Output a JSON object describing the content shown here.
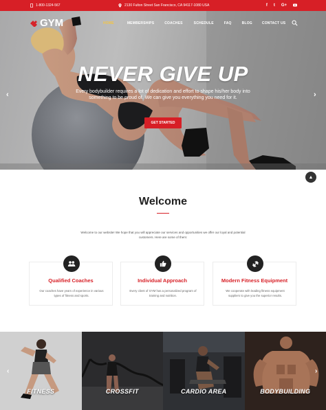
{
  "topbar": {
    "phone": "1-800-1324-567",
    "address": "2130 Fulton Street San Francisco, CA 94117-1080 USA",
    "social": [
      "f",
      "t",
      "G+",
      "yt"
    ]
  },
  "brand": {
    "name": "GYM",
    "color": "#d71f26"
  },
  "nav": {
    "items": [
      "HOME",
      "MEMBERSHIPS",
      "COACHES",
      "SCHEDULE",
      "FAQ",
      "BLOG",
      "CONTACT US"
    ],
    "active": "HOME"
  },
  "hero": {
    "title": "NEVER GIVE UP",
    "subtitle": "Every bodybuilder requires a lot of dedication and effort to shape his/her body into something to be proud of. We can give you everything you need for it.",
    "cta": "GET STARTED",
    "prev": "‹",
    "next": "›"
  },
  "welcome": {
    "title": "Welcome",
    "text": "Welcome to our website! We hope that you will appreciate our services and opportunities we offer our loyal and potential customers. Here are some of them:",
    "scroll_top": "▲"
  },
  "features": [
    {
      "icon": "group-icon",
      "title": "Qualified Coaches",
      "text": "Our coaches have years of experience in various types of fitness and sports."
    },
    {
      "icon": "thumbs-up-icon",
      "title": "Individual Approach",
      "text": "Every client of GYM has a personalized program of training and nutrition."
    },
    {
      "icon": "dumbbell-icon",
      "title": "Modern Fitness Equipment",
      "text": "We cooperate with leading fitness equipment suppliers to give you the superior results."
    }
  ],
  "gallery": {
    "tiles": [
      "FITNESS",
      "CROSSFIT",
      "CARDIO AREA",
      "BODYBUILDING"
    ],
    "prev": "‹",
    "next": "›"
  }
}
